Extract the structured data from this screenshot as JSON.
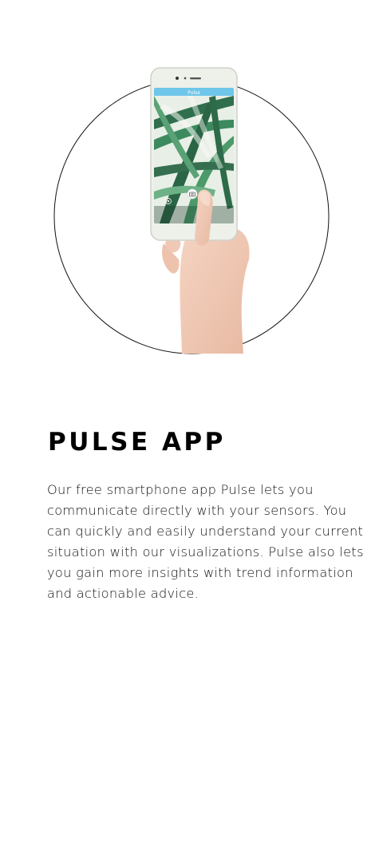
{
  "product": {
    "title": "PULSE APP",
    "description": "Our free smartphone app Pulse lets you communicate directly with your sensors. You can quickly and easily understand your current situation with our visualizations. Pulse also lets you gain more insights with trend information and actionable advice."
  },
  "phone_screen": {
    "app_header": "Pulse"
  },
  "colors": {
    "circle_stroke": "#111111",
    "app_header_bg": "#6ec6ea",
    "leaf_green": "#2f6f4e",
    "phone_body": "#eef0ea"
  },
  "icons": [
    "camera-icon",
    "settings-icon"
  ]
}
